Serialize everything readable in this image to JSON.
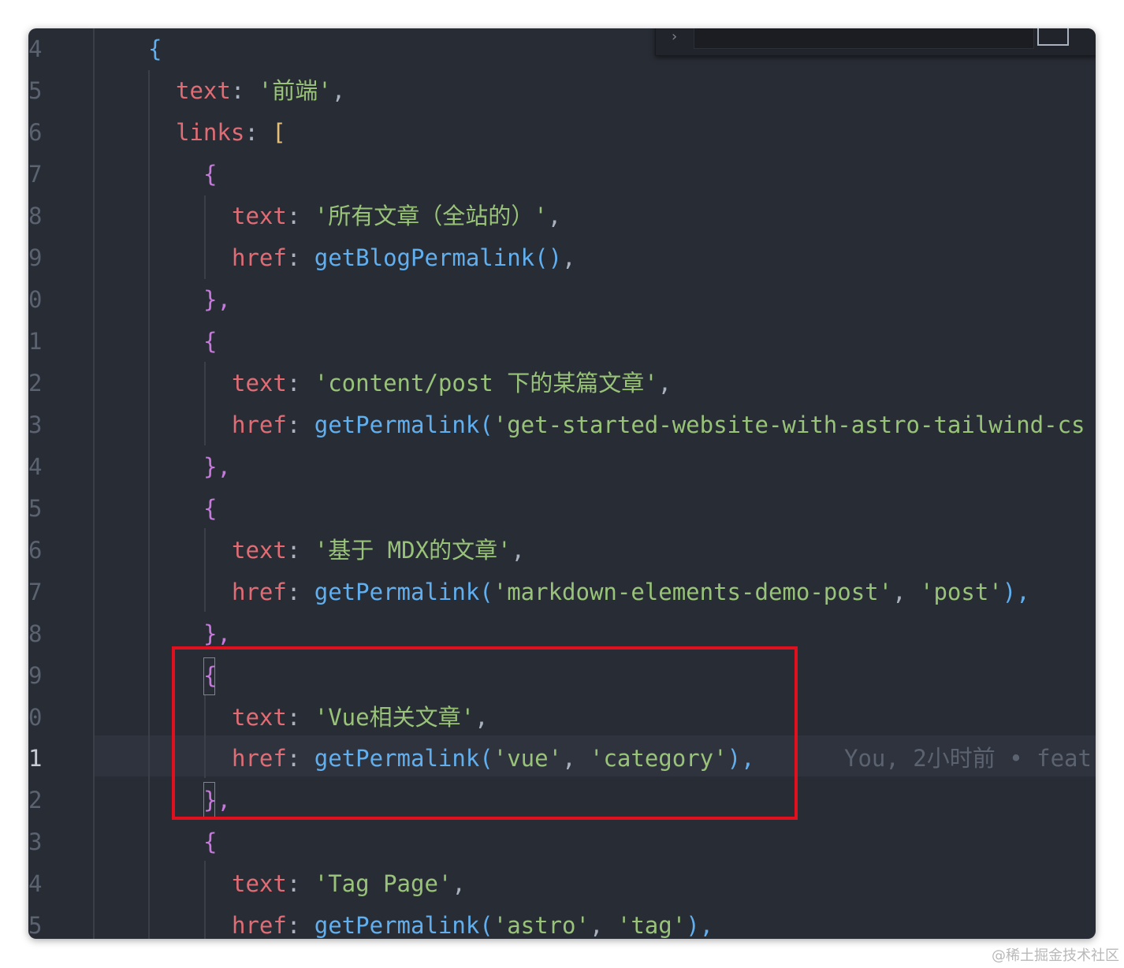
{
  "editor": {
    "lines": [
      {
        "number": "4"
      },
      {
        "number": "5"
      },
      {
        "number": "6"
      },
      {
        "number": "7"
      },
      {
        "number": "8"
      },
      {
        "number": "9"
      },
      {
        "number": "0"
      },
      {
        "number": "1"
      },
      {
        "number": "2"
      },
      {
        "number": "3"
      },
      {
        "number": "4"
      },
      {
        "number": "5"
      },
      {
        "number": "6"
      },
      {
        "number": "7"
      },
      {
        "number": "8"
      },
      {
        "number": "9"
      },
      {
        "number": "0"
      },
      {
        "number": "1"
      },
      {
        "number": "2"
      },
      {
        "number": "3"
      },
      {
        "number": "4"
      },
      {
        "number": "5"
      }
    ],
    "tokens": {
      "open_brace": "{",
      "close_brace_comma": "},",
      "text_key": "text",
      "href_key": "href",
      "colon": ": ",
      "comma": ",",
      "links_key": "links",
      "open_bracket": "[",
      "line5_str": "'前端'",
      "line8_str": "'所有文章（全站的）'",
      "line9_fn": "getBlogPermalink",
      "line9_args": "()",
      "line12_str": "'content/post 下的某篇文章'",
      "line13_fn": "getPermalink",
      "line13_str": "'get-started-website-with-astro-tailwind-cs",
      "line16_str": "'基于 MDX的文章'",
      "line17_fn": "getPermalink",
      "line17_str1": "'markdown-elements-demo-post'",
      "line17_str2": "'post'",
      "line20_str": "'Vue相关文章'",
      "line21_fn": "getPermalink",
      "line21_str1": "'vue'",
      "line21_str2": "'category'",
      "line24_str": "'Tag Page'",
      "line25_fn": "getPermalink",
      "line25_str1": "'astro'",
      "line25_str2": "'tag'",
      "paren_open": "(",
      "paren_close_comma": "),",
      "sep": ", "
    },
    "blame": "You, 2小时前 • feat",
    "highlight_color": "#e0101e",
    "colors": {
      "background": "#282c34",
      "key": "#e06c75",
      "string": "#98c379",
      "function": "#61afef",
      "brace_level1": "#61afef",
      "brace_level2": "#c678dd",
      "bracket": "#e5c07b"
    }
  },
  "find_widget": {
    "chevron_icon": "chevron-right-icon"
  },
  "watermark": "@稀土掘金技术社区"
}
